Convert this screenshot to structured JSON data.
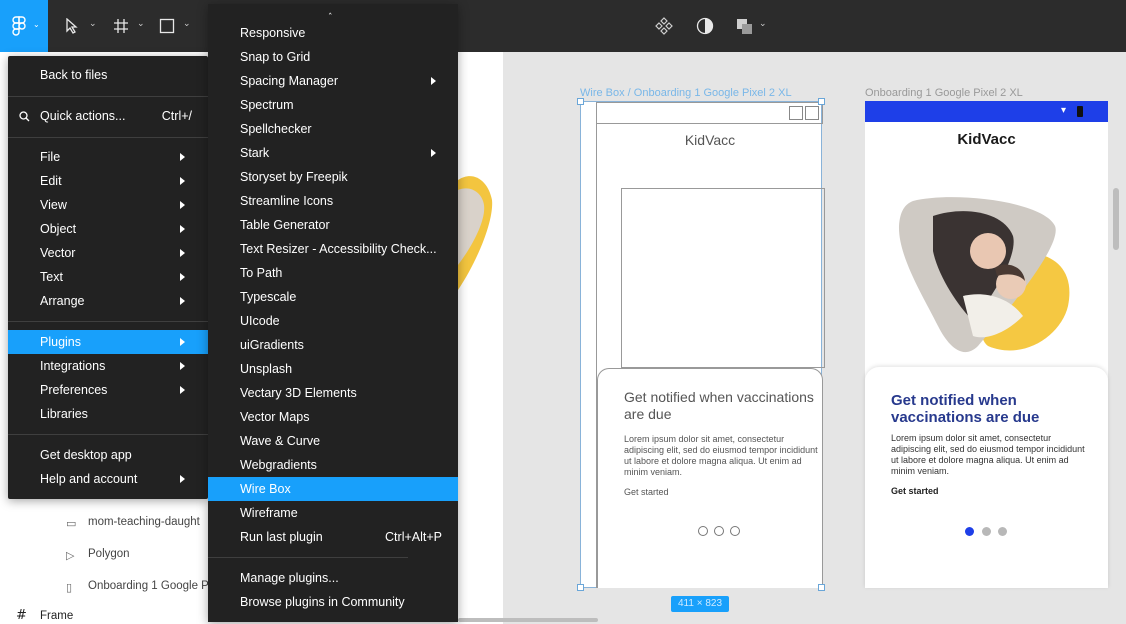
{
  "toolbar": {
    "caret": "⌄"
  },
  "main_menu": {
    "items": [
      {
        "label": "Back to files"
      },
      {
        "label": "Quick actions...",
        "shortcut": "Ctrl+/"
      },
      {
        "label": "File"
      },
      {
        "label": "Edit"
      },
      {
        "label": "View"
      },
      {
        "label": "Object"
      },
      {
        "label": "Vector"
      },
      {
        "label": "Text"
      },
      {
        "label": "Arrange"
      },
      {
        "label": "Plugins"
      },
      {
        "label": "Integrations"
      },
      {
        "label": "Preferences"
      },
      {
        "label": "Libraries"
      },
      {
        "label": "Get desktop app"
      },
      {
        "label": "Help and account"
      }
    ]
  },
  "plugins_menu": {
    "up_caret": "ˆ",
    "items": [
      {
        "label": "Responsive"
      },
      {
        "label": "Snap to Grid"
      },
      {
        "label": "Spacing Manager"
      },
      {
        "label": "Spectrum"
      },
      {
        "label": "Spellchecker"
      },
      {
        "label": "Stark"
      },
      {
        "label": "Storyset by Freepik"
      },
      {
        "label": "Streamline Icons"
      },
      {
        "label": "Table Generator"
      },
      {
        "label": "Text Resizer - Accessibility Check..."
      },
      {
        "label": "To Path"
      },
      {
        "label": "Typescale"
      },
      {
        "label": "UIcode"
      },
      {
        "label": "uiGradients"
      },
      {
        "label": "Unsplash"
      },
      {
        "label": "Vectary 3D Elements"
      },
      {
        "label": "Vector Maps"
      },
      {
        "label": "Wave & Curve"
      },
      {
        "label": "Webgradients"
      },
      {
        "label": "Wire Box"
      },
      {
        "label": "Wireframe"
      },
      {
        "label": "Run last plugin",
        "shortcut": "Ctrl+Alt+P"
      },
      {
        "label": "Manage plugins..."
      },
      {
        "label": "Browse plugins in Community"
      }
    ]
  },
  "layers": {
    "rows": [
      {
        "label": "mom-teaching-daught"
      },
      {
        "label": "Polygon"
      },
      {
        "label": "Onboarding 1 Google P"
      }
    ],
    "frame_label": "Frame"
  },
  "wire_frame": {
    "label": "Wire Box / Onboarding 1 Google Pixel 2 XL",
    "title": "KidVacc",
    "heading": "Get notified when vaccinations are due",
    "body": "Lorem ipsum dolor sit amet, consectetur adipiscing elit, sed do eiusmod tempor incididunt ut labore et dolore magna aliqua. Ut enim ad minim veniam.",
    "cta": "Get started",
    "size": "411 × 823"
  },
  "real_frame": {
    "label": "Onboarding 1 Google Pixel 2 XL",
    "title": "KidVacc",
    "heading": "Get notified when vaccinations are due",
    "body": "Lorem ipsum dolor sit amet, consectetur adipiscing elit, sed do eiusmod tempor incididunt ut labore et dolore magna aliqua. Ut enim ad minim veniam.",
    "cta": "Get started",
    "status_icons": [
      "wifi-icon",
      "battery-icon"
    ]
  },
  "colors": {
    "accent": "#18a0fb",
    "menu_bg": "#222222",
    "toolbar_bg": "#2c2c2c",
    "phone_status_blue": "#1e3fe8",
    "heading_navy": "#27398d",
    "illustration_yellow": "#f5c842",
    "dot_active": "#1e3fe8"
  }
}
